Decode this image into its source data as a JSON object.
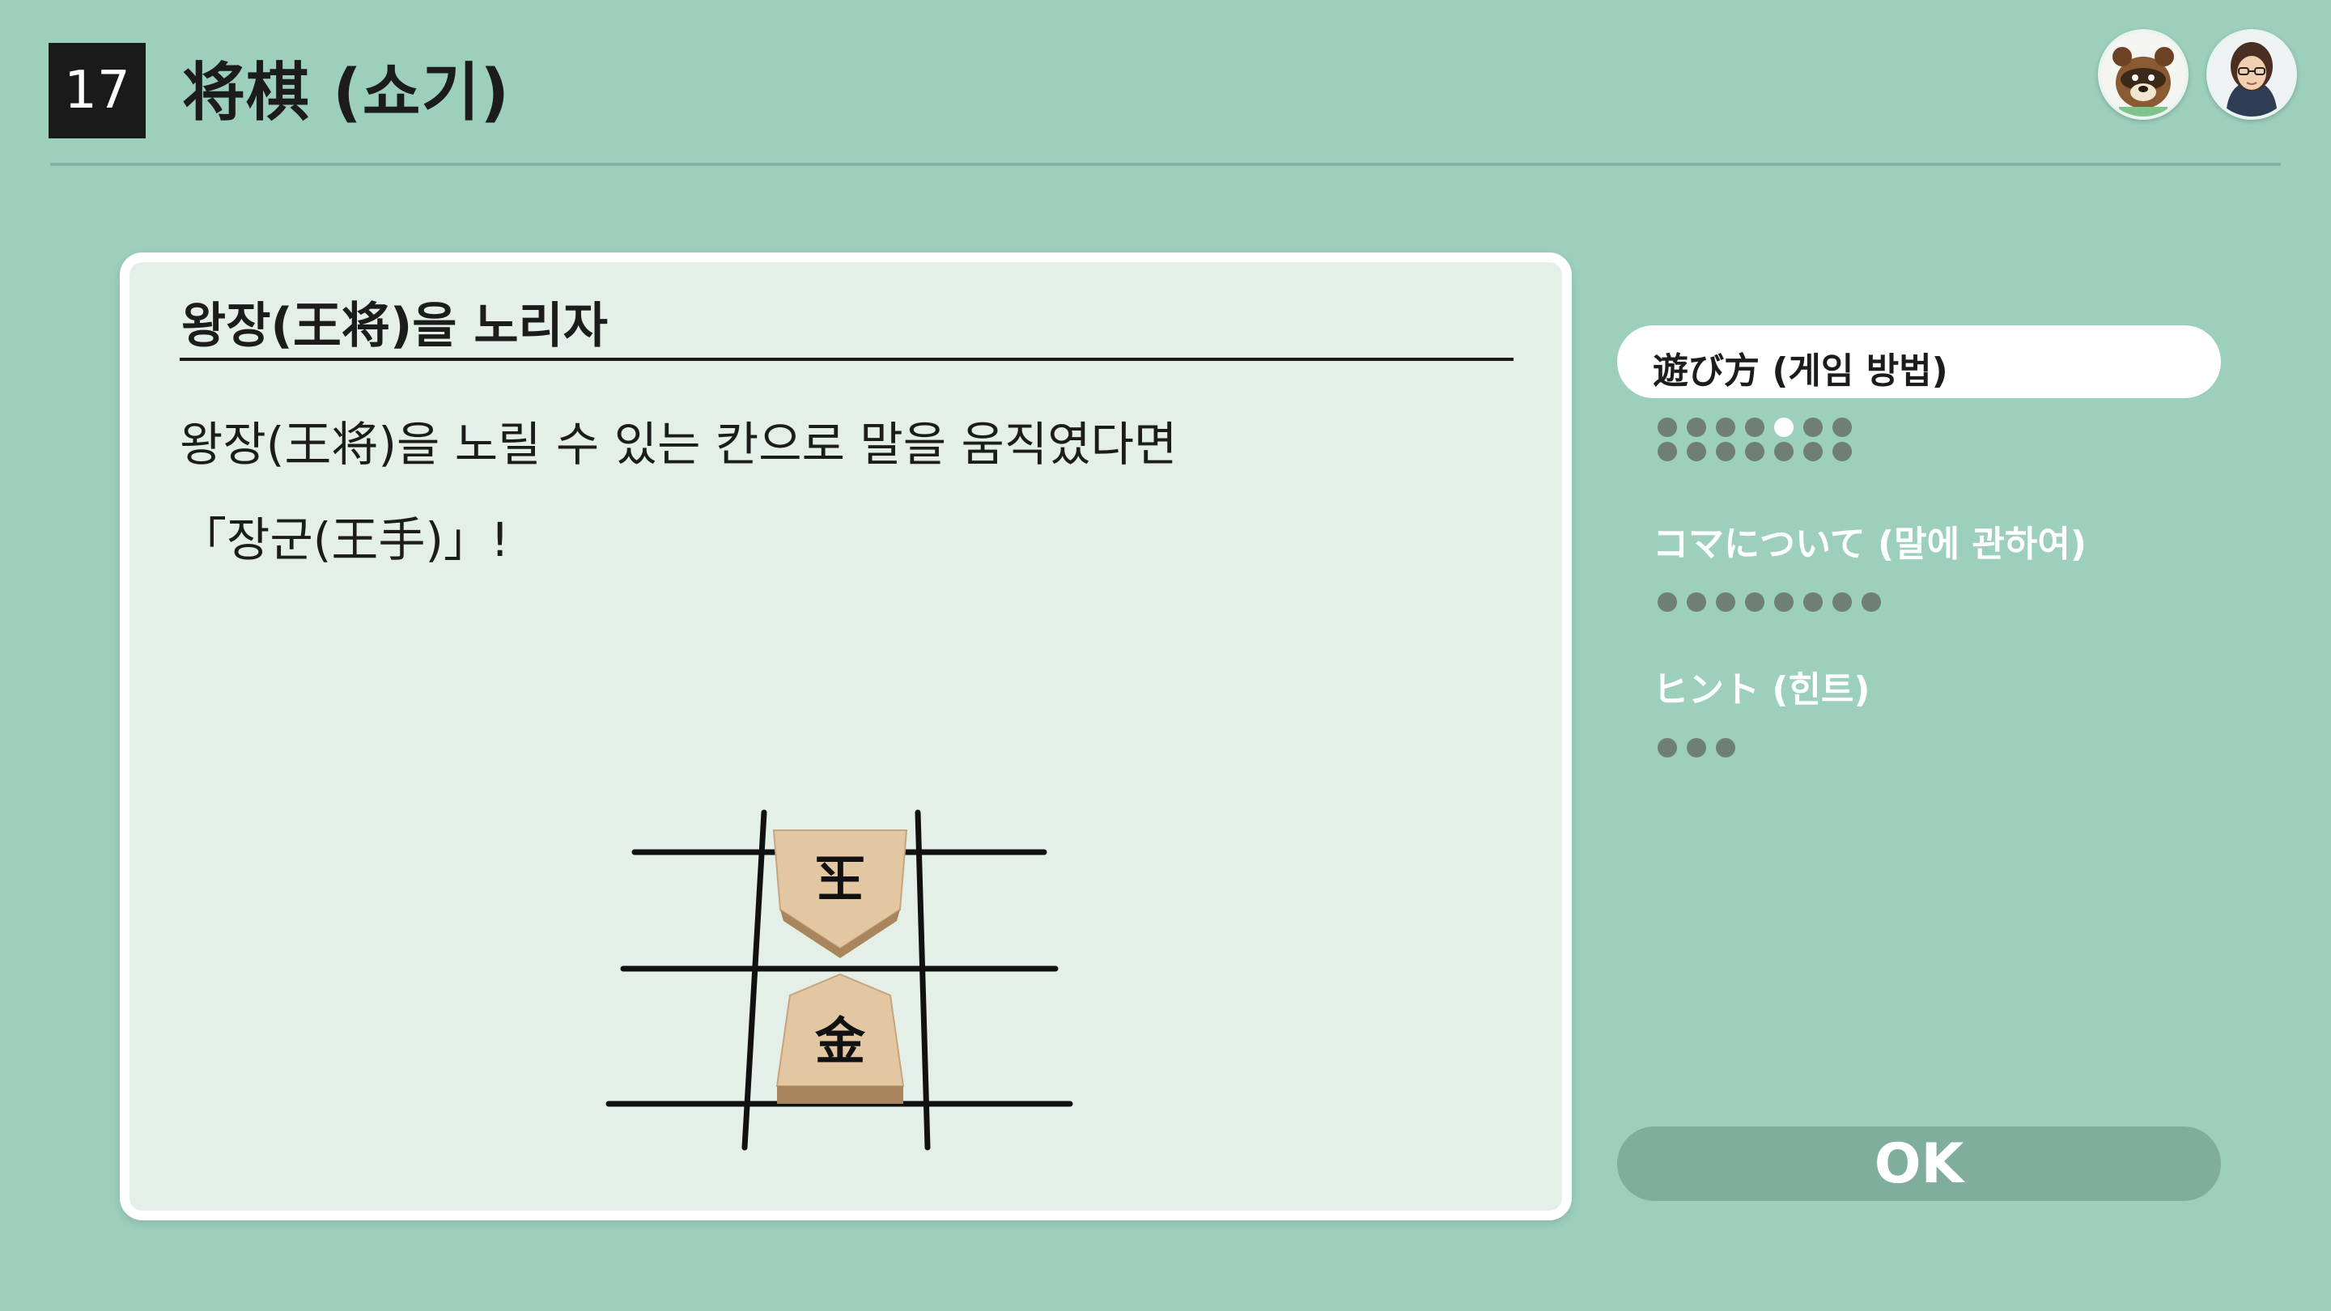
{
  "header": {
    "number": "17",
    "title": "将棋 (쇼기)"
  },
  "avatars": [
    {
      "name": "tom-nook-avatar-icon"
    },
    {
      "name": "player-avatar-icon"
    }
  ],
  "panel": {
    "title": "왕장(王将)을 노리자",
    "line1": "왕장(王将)을 노릴 수 있는 칸으로 말을 움직였다면",
    "line2": "「장군(王手)」!",
    "pieces": [
      {
        "glyph": "玉将",
        "orientation": "opponent"
      },
      {
        "glyph": "金将",
        "orientation": "player"
      }
    ]
  },
  "menu": {
    "sections": [
      {
        "label": "遊び方 (게임 방법)",
        "selected": true,
        "pages": 14,
        "current_page": 4
      },
      {
        "label": "コマについて (말에 관하여)",
        "selected": false,
        "pages": 8
      },
      {
        "label": "ヒント (힌트)",
        "selected": false,
        "pages": 3
      }
    ]
  },
  "ok_label": "OK",
  "colors": {
    "background": "#9dcfbd",
    "panel": "#e4f0e7",
    "dot_inactive": "#6f7e77",
    "dot_active": "#ffffff",
    "ok_button": "#80ae9d"
  }
}
